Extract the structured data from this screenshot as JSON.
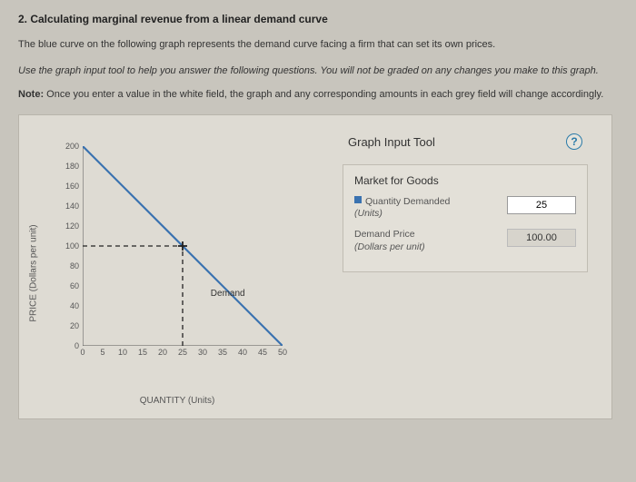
{
  "question": {
    "title": "2. Calculating marginal revenue from a linear demand curve",
    "intro": "The blue curve on the following graph represents the demand curve facing a firm that can set its own prices.",
    "instruction": "Use the graph input tool to help you answer the following questions. You will not be graded on any changes you make to this graph.",
    "note_prefix": "Note: ",
    "note_body": "Once you enter a value in the white field, the graph and any corresponding amounts in each grey field will change accordingly."
  },
  "tool": {
    "header": "Graph Input Tool",
    "help": "?",
    "panel_title": "Market for Goods",
    "qty_label": "Quantity Demanded",
    "qty_sub": "(Units)",
    "qty_value": "25",
    "price_label": "Demand Price",
    "price_sub": "(Dollars per unit)",
    "price_value": "100.00"
  },
  "chart_data": {
    "type": "line",
    "title": "",
    "xlabel": "QUANTITY (Units)",
    "ylabel": "PRICE (Dollars per unit)",
    "xlim": [
      0,
      50
    ],
    "ylim": [
      0,
      200
    ],
    "xticks": [
      0,
      5,
      10,
      15,
      20,
      25,
      30,
      35,
      40,
      45,
      50
    ],
    "yticks": [
      0,
      20,
      40,
      60,
      80,
      100,
      120,
      140,
      160,
      180,
      200
    ],
    "series": [
      {
        "name": "Demand",
        "color": "#3a72b0",
        "x": [
          0,
          50
        ],
        "y": [
          200,
          0
        ]
      }
    ],
    "marker": {
      "x": 25,
      "y": 100,
      "style": "cross",
      "color": "#222"
    },
    "guides": [
      {
        "type": "hline",
        "y": 100,
        "x_from": 0,
        "x_to": 25,
        "dashed": true,
        "color": "#222"
      },
      {
        "type": "vline",
        "x": 25,
        "y_from": 0,
        "y_to": 100,
        "dashed": true,
        "color": "#222"
      }
    ],
    "curve_label": "Demand"
  }
}
